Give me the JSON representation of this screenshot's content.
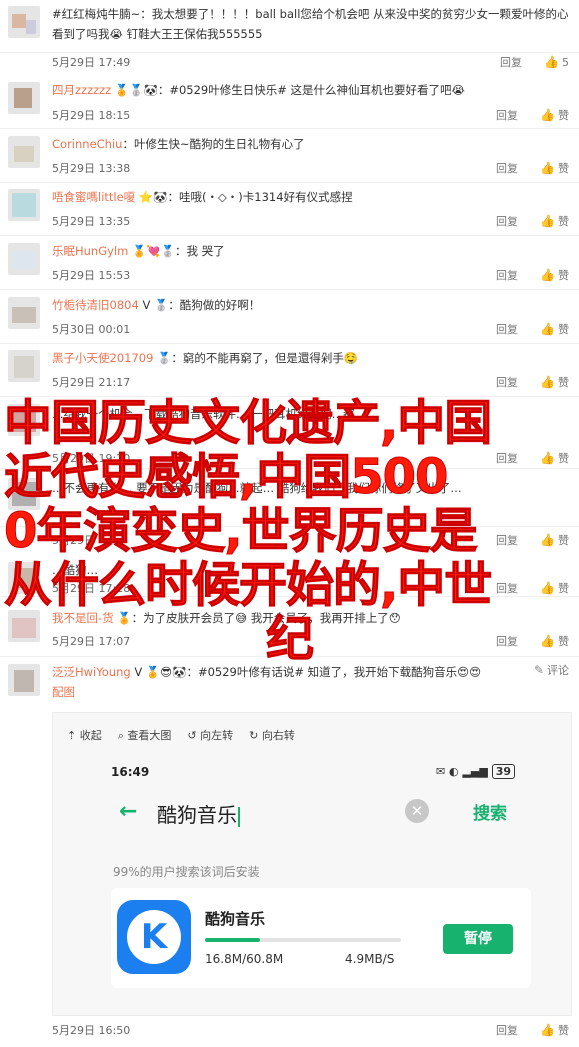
{
  "comments": [
    {
      "user": "",
      "text": "#红红梅炖牛腩~：我太想要了！！！！ball ball您给个机会吧 从来没中奖的贫穷少女一颗爱叶修的心看到了吗我😭 钉鞋大王王保佑我555555",
      "time": "5月29日 17:49",
      "reply": "回复",
      "likes": "5"
    },
    {
      "user": "四月zzzzzz",
      "text": "🏅🥈🐼：#0529叶修生日快乐# 这是什么神仙耳机也要好看了吧😭",
      "time": "5月29日 18:15",
      "reply": "回复",
      "likes": "赞"
    },
    {
      "user": "CorinneChiu",
      "text": "：叶修生快~酷狗的生日礼物有心了",
      "time": "5月29日 13:38",
      "reply": "回复",
      "likes": "赞"
    },
    {
      "user": "唔食蜜嗎little嗄",
      "text": "⭐🐼：哇哦(・◇・)卡1314好有仪式感捏",
      "time": "5月29日 13:35",
      "reply": "回复",
      "likes": "赞"
    },
    {
      "user": "乐眠HunGylm",
      "text": "🏅💘🥈：我    哭了",
      "time": "5月29日 15:53",
      "reply": "回复",
      "likes": "赞"
    },
    {
      "user": "竹栀待清旧0804",
      "text": "V 🥈：酷狗做的好啊！",
      "time": "5月30日 00:01",
      "reply": "回复",
      "likes": "赞"
    },
    {
      "user": "黑子小天使201709",
      "text": "🥈：窮的不能再窮了，但是還得剁手🤤",
      "time": "5月29日 21:17",
      "reply": "回复",
      "likes": "赞"
    },
    {
      "user": "",
      "text": "…给我一个机会，下载酷狗音乐软件… 一把耳机给我们…都",
      "time": "5月29日 19:20",
      "reply": "回复",
      "likes": "赞"
    },
    {
      "user": "",
      "text": "…不会再有你… 要不是因为是酷狗…就起… 酷狗给我们…我们你们修了又出了…",
      "time": "5月29日",
      "reply": "回复",
      "likes": "赞"
    },
    {
      "user": "",
      "text": "…酷狗…",
      "time": "5月29日 17:28",
      "reply": "回复",
      "likes": "赞"
    },
    {
      "user": "我不是回-货",
      "text": "🏅：为了皮肤开会员了😅 我开会员了，我再开排上了😯",
      "time": "5月29日 17:07",
      "reply": "回复",
      "likes": "赞"
    },
    {
      "user": "泛泛HwiYoung",
      "text": "V 🏅😎🐼：#0529叶修有话说# 知道了，我开始下载酷狗音乐😍😍",
      "time": "",
      "reply": "",
      "likes": "评论"
    }
  ],
  "image_link": "配图",
  "shot": {
    "toolbar": [
      "收起",
      "查看大图",
      "向左转",
      "向右转"
    ],
    "status_time": "16:49",
    "status_right": "39",
    "search_text": "酷狗音乐",
    "search_button": "搜索",
    "hint": "99%的用户搜索该词后安装",
    "app_name": "酷狗音乐",
    "app_icon_letter": "K",
    "size": "16.8M/60.8M",
    "speed": "4.9MB/S",
    "progress": 0.28,
    "pause": "暂停"
  },
  "last_time": "5月29日 16:50",
  "last_reply": "回复",
  "last_likes": "赞",
  "watermark": [
    "中国历史文化遗产,中国",
    "近代史感悟,中国500",
    "0年演变史,世界历史是",
    "从什么时候开始的,中世",
    "纪"
  ]
}
